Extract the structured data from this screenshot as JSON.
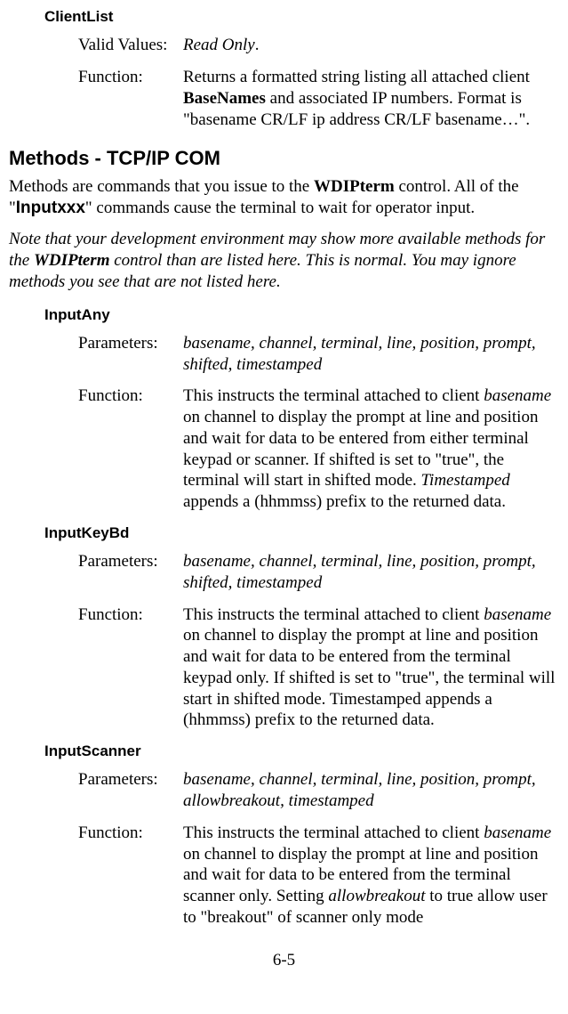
{
  "clientlist": {
    "title": "ClientList",
    "valid_label": "Valid Values:",
    "valid_value_a": "Read Only",
    "valid_value_b": ".",
    "func_label": "Function:",
    "func_value_a": "Returns a formatted string listing all attached client ",
    "func_value_b": "BaseNames",
    "func_value_c": " and associated IP numbers. Format is \"basename CR/LF ip address CR/LF basename…\"."
  },
  "methods": {
    "heading": "Methods - TCP/IP COM",
    "intro_a": "Methods are commands that you issue to the ",
    "intro_b": "WDIPterm",
    "intro_c": " control. All of the \"",
    "intro_d": "Inputxxx",
    "intro_e": "\" commands cause the terminal to wait for operator input.",
    "note_a": "Note that your development environment may show more available methods for the ",
    "note_b": "WDIPterm",
    "note_c": " control than are listed here. This is normal. You may ignore methods you see that are not listed here."
  },
  "inputany": {
    "title": "InputAny",
    "params_label": "Parameters:",
    "params_value": "basename, channel, terminal, line, position, prompt, shifted, timestamped",
    "func_label": "Function:",
    "func_a": "This instructs the terminal attached to client ",
    "func_b": "basename",
    "func_c": " on channel to display the prompt at line and position and wait for data to be entered from either terminal keypad or scanner. If shifted is set to \"true\", the terminal will start in shifted mode. ",
    "func_d": "Timestamped",
    "func_e": " appends a (hhmmss) prefix to the returned data."
  },
  "inputkeybd": {
    "title": "InputKeyBd",
    "params_label": "Parameters:",
    "params_value": "basename, channel, terminal, line, position, prompt, shifted, timestamped",
    "func_label": "Function:",
    "func_a": "This instructs the terminal attached to client ",
    "func_b": "basename",
    "func_c": " on channel to display the prompt at line and position and wait for data to be entered from the terminal keypad only. If shifted is set to \"true\", the terminal will start in shifted mode. Timestamped appends a (hhmmss) prefix to the returned data."
  },
  "inputscanner": {
    "title": "InputScanner",
    "params_label": "Parameters:",
    "params_value": "basename, channel, terminal, line, position, prompt, allowbreakout, timestamped",
    "func_label": "Function:",
    "func_a": "This instructs the terminal attached to client ",
    "func_b": "basename",
    "func_c": " on channel to display the prompt at line and position and wait for data to be entered from the terminal scanner only. Setting ",
    "func_d": "allowbreakout",
    "func_e": " to true allow user to \"breakout\" of scanner only mode"
  },
  "pagenum": "6-5"
}
